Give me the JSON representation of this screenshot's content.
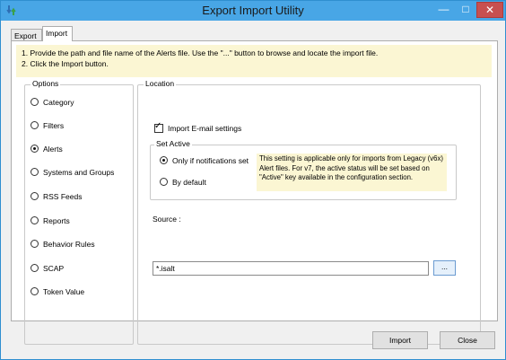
{
  "window": {
    "title": "Export Import Utility",
    "app_icon": "utility-app-icon",
    "controls": {
      "minimize": "—",
      "maximize": "□",
      "close": "✕"
    }
  },
  "tabs": [
    {
      "label": "Export",
      "selected": false
    },
    {
      "label": "Import",
      "selected": true
    }
  ],
  "instructions": {
    "line1": "1. Provide the path and file name of the Alerts file. Use the \"...\" button to browse and locate the import file.",
    "line2": "2. Click the Import button."
  },
  "options": {
    "label": "Options",
    "items": [
      {
        "label": "Category",
        "checked": false
      },
      {
        "label": "Filters",
        "checked": false
      },
      {
        "label": "Alerts",
        "checked": true
      },
      {
        "label": "Systems and Groups",
        "checked": false
      },
      {
        "label": "RSS Feeds",
        "checked": false
      },
      {
        "label": "Reports",
        "checked": false
      },
      {
        "label": "Behavior Rules",
        "checked": false
      },
      {
        "label": "SCAP",
        "checked": false
      },
      {
        "label": "Token Value",
        "checked": false
      }
    ]
  },
  "location": {
    "label": "Location",
    "import_email": {
      "label": "Import E-mail settings",
      "checked": true
    },
    "set_active": {
      "label": "Set Active",
      "options": [
        {
          "label": "Only if notifications set",
          "checked": true
        },
        {
          "label": "By default",
          "checked": false
        }
      ],
      "note": "This setting is applicable only for imports from Legacy (v6x) Alert files. For v7, the active status will be set based on \"Active\" key available in the configuration section."
    },
    "source": {
      "label": "Source :",
      "value": "*.isalt",
      "browse_label": "..."
    }
  },
  "buttons": {
    "import": "Import",
    "close": "Close"
  },
  "colors": {
    "titlebar": "#48a6e6",
    "close_button": "#c75050",
    "note_background": "#fbf6d3"
  }
}
